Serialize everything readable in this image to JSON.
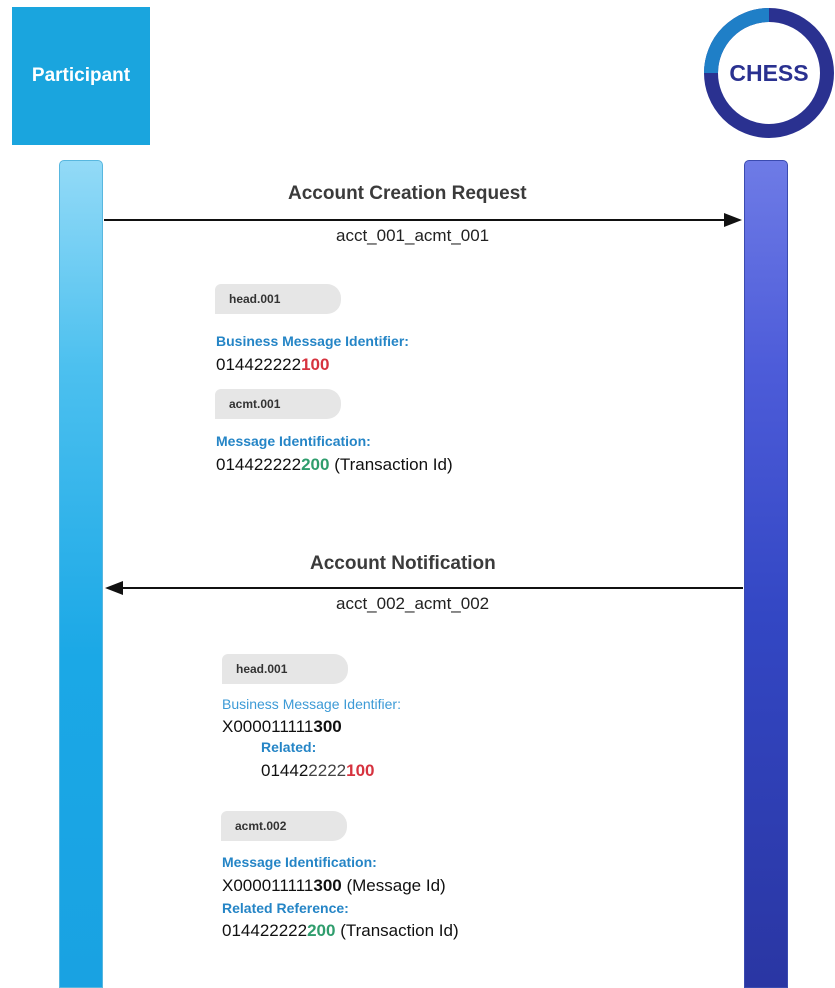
{
  "participant": {
    "label": "Participant"
  },
  "chess": {
    "label": "CHESS"
  },
  "colors": {
    "participant": "#1aa5de",
    "chess_dark": "#2a3190",
    "chess_ring": "#1f7fc7"
  },
  "messages": [
    {
      "title": "Account Creation Request",
      "code": "acct_001_acmt_001",
      "direction": "participant-to-chess",
      "head_tag": "head.001",
      "bmi_label": "Business Message Identifier:",
      "bmi_prefix": "014422222",
      "bmi_suffix": "100",
      "body_tag": "acmt.001",
      "mid_label": "Message Identification:",
      "mid_prefix": "014422222",
      "mid_suffix": "200",
      "mid_note": " (Transaction Id)"
    },
    {
      "title": "Account Notification",
      "code": "acct_002_acmt_002",
      "direction": "chess-to-participant",
      "head_tag": "head.001",
      "bmi_label": "Business Message Identifier:",
      "bmi_prefix": "X000011111",
      "bmi_suffix": "300",
      "related_label": "Related:",
      "related_prefix_dark": "01442",
      "related_prefix_grey": "2222",
      "related_suffix": "100",
      "body_tag": "acmt.002",
      "mid_label": "Message Identification:",
      "mid_prefix": "X000011111",
      "mid_suffix": "300",
      "mid_note": " (Message Id)",
      "ref_label": "Related Reference:",
      "ref_prefix": "014422222",
      "ref_suffix": "200",
      "ref_note": " (Transaction Id)"
    }
  ]
}
